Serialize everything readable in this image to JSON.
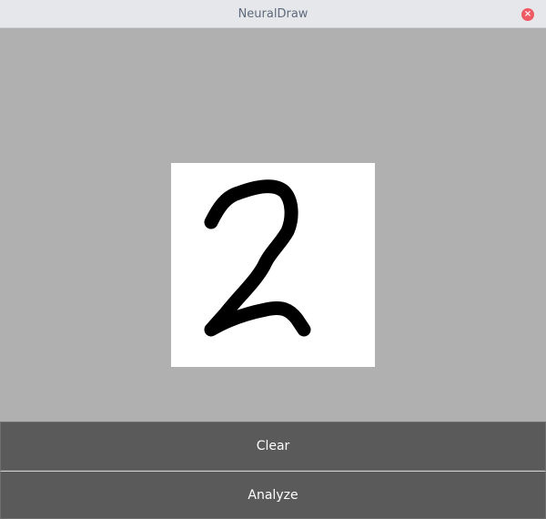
{
  "window": {
    "title": "NeuralDraw",
    "close_icon": "close-icon"
  },
  "canvas": {
    "drawn_digit": "2",
    "stroke_color": "#000000",
    "background": "#ffffff"
  },
  "buttons": {
    "clear": "Clear",
    "analyze": "Analyze"
  }
}
